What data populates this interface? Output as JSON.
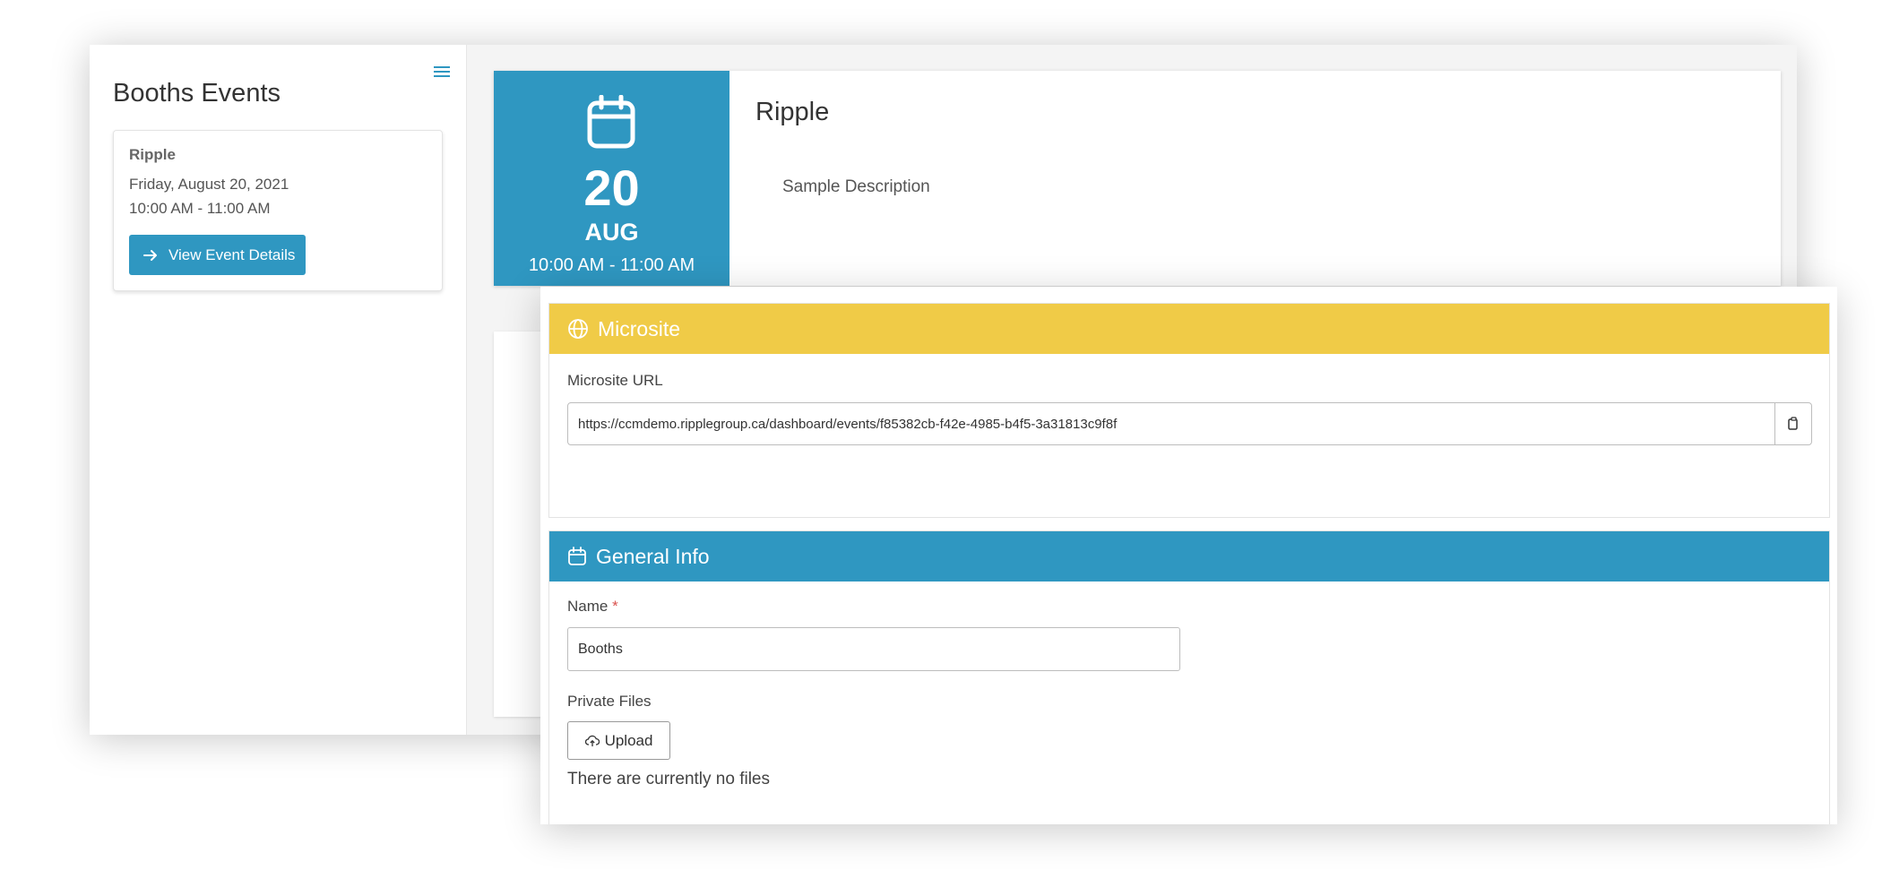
{
  "sidebar": {
    "title": "Booths Events",
    "menu_icon": "hamburger-menu-icon",
    "event_card": {
      "name": "Ripple",
      "date": "Friday, August 20, 2021",
      "time": "10:00 AM - 11:00 AM",
      "button_label": "View Event Details",
      "button_icon": "arrow-right-icon"
    }
  },
  "event": {
    "day": "20",
    "month": "AUG",
    "time": "10:00 AM - 11:00 AM",
    "title": "Ripple",
    "description": "Sample Description",
    "icon": "calendar-icon"
  },
  "microsite": {
    "header": "Microsite",
    "header_icon": "globe-icon",
    "url_label": "Microsite URL",
    "url_value": "https://ccmdemo.ripplegroup.ca/dashboard/events/f85382cb-f42e-4985-b4f5-3a31813c9f8f",
    "copy_icon": "clipboard-copy-icon"
  },
  "general_info": {
    "header": "General Info",
    "header_icon": "calendar-icon",
    "name_label": "Name",
    "name_required_mark": "*",
    "name_value": "Booths",
    "files_label": "Private Files",
    "upload_label": "Upload",
    "upload_icon": "cloud-upload-icon",
    "no_files_text": "There are currently no files"
  },
  "colors": {
    "primary_blue": "#2f97c1",
    "microsite_yellow": "#f0cb47",
    "required_red": "#d9534f"
  }
}
